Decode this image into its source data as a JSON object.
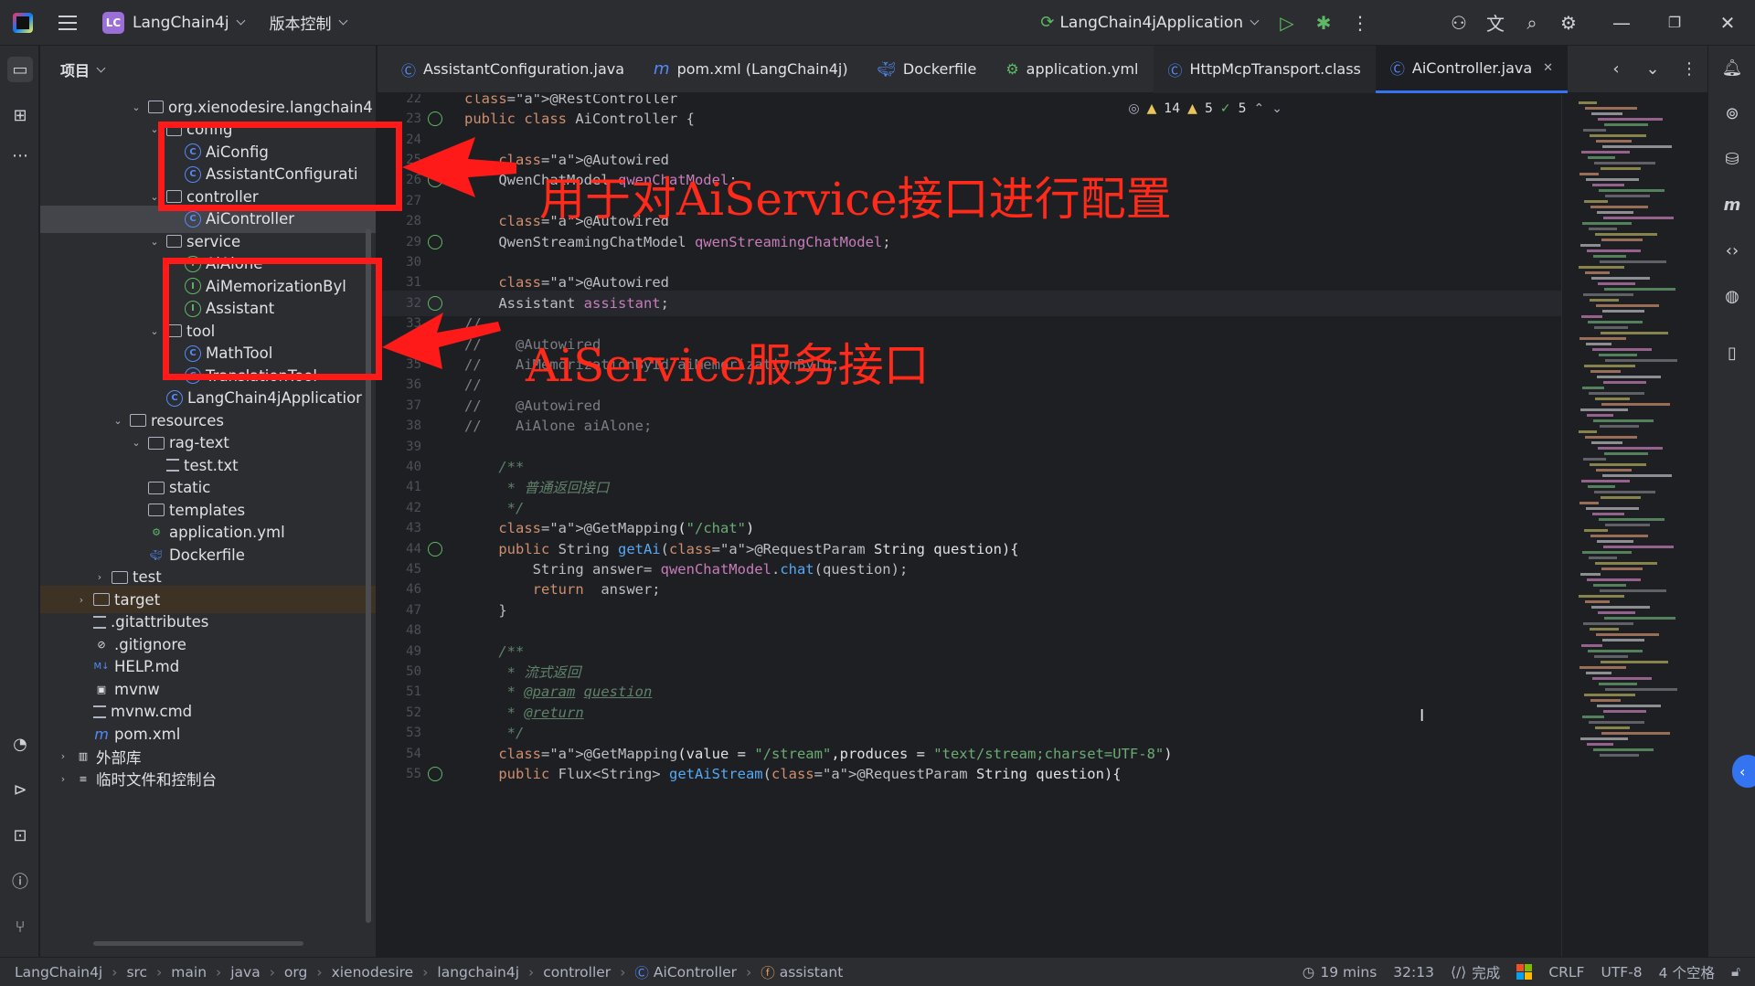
{
  "titlebar": {
    "project_badge": "LC",
    "project_name": "LangChain4j",
    "vcs_label": "版本控制",
    "run_config": "LangChain4jApplication"
  },
  "project_panel": {
    "header": "项目",
    "tree": [
      {
        "label": "org.xienodesire.langchain4",
        "type": "package",
        "arrow": "v"
      },
      {
        "label": "config",
        "type": "package",
        "arrow": "v"
      },
      {
        "label": "AiConfig",
        "type": "class"
      },
      {
        "label": "AssistantConfigurati",
        "type": "class"
      },
      {
        "label": "controller",
        "type": "package",
        "arrow": "v"
      },
      {
        "label": "AiController",
        "type": "class"
      },
      {
        "label": "service",
        "type": "package",
        "arrow": "v"
      },
      {
        "label": "AiAlone",
        "type": "interface"
      },
      {
        "label": "AiMemorizationByl",
        "type": "interface"
      },
      {
        "label": "Assistant",
        "type": "interface"
      },
      {
        "label": "tool",
        "type": "package",
        "arrow": "v"
      },
      {
        "label": "MathTool",
        "type": "class"
      },
      {
        "label": "TranslationTool",
        "type": "class"
      },
      {
        "label": "LangChain4jApplicatior",
        "type": "class"
      },
      {
        "label": "resources",
        "type": "folder",
        "arrow": "v"
      },
      {
        "label": "rag-text",
        "type": "folder",
        "arrow": "v"
      },
      {
        "label": "test.txt",
        "type": "file"
      },
      {
        "label": "static",
        "type": "folder"
      },
      {
        "label": "templates",
        "type": "folder"
      },
      {
        "label": "application.yml",
        "type": "yml"
      },
      {
        "label": "Dockerfile",
        "type": "docker"
      },
      {
        "label": "test",
        "type": "folder",
        "arrow": ">"
      },
      {
        "label": "target",
        "type": "folder",
        "arrow": ">"
      },
      {
        "label": ".gitattributes",
        "type": "file"
      },
      {
        "label": ".gitignore",
        "type": "ignore"
      },
      {
        "label": "HELP.md",
        "type": "md"
      },
      {
        "label": "mvnw",
        "type": "term"
      },
      {
        "label": "mvnw.cmd",
        "type": "file"
      },
      {
        "label": "pom.xml",
        "type": "maven"
      },
      {
        "label": "外部库",
        "type": "lib",
        "arrow": ">"
      },
      {
        "label": "临时文件和控制台",
        "type": "scratch",
        "arrow": ">"
      }
    ]
  },
  "tabs": [
    {
      "label": "AssistantConfiguration.java",
      "icon": "class-icon"
    },
    {
      "label": "pom.xml (LangChain4j)",
      "icon": "maven-icon"
    },
    {
      "label": "Dockerfile",
      "icon": "docker-icon"
    },
    {
      "label": "application.yml",
      "icon": "yml-icon"
    },
    {
      "label": "HttpMcpTransport.class",
      "icon": "class-icon"
    },
    {
      "label": "AiController.java",
      "icon": "class-icon",
      "active": true
    }
  ],
  "inspections": {
    "warnings": "14",
    "weak_warnings": "5",
    "typos": "5"
  },
  "code_lines": [
    {
      "n": "22",
      "t": "@RestController"
    },
    {
      "n": "23",
      "t": "public class AiController {"
    },
    {
      "n": "24",
      "t": ""
    },
    {
      "n": "25",
      "t": "    @Autowired"
    },
    {
      "n": "26",
      "t": "    QwenChatModel qwenChatModel;"
    },
    {
      "n": "27",
      "t": ""
    },
    {
      "n": "28",
      "t": "    @Autowired"
    },
    {
      "n": "29",
      "t": "    QwenStreamingChatModel qwenStreamingChatModel;"
    },
    {
      "n": "30",
      "t": ""
    },
    {
      "n": "31",
      "t": "    @Autowired"
    },
    {
      "n": "32",
      "t": "    Assistant assistant;"
    },
    {
      "n": "33",
      "t": "//"
    },
    {
      "n": "34",
      "t": "//    @Autowired"
    },
    {
      "n": "35",
      "t": "//    AiMemorizationById aiMemorizationById;"
    },
    {
      "n": "36",
      "t": "//"
    },
    {
      "n": "37",
      "t": "//    @Autowired"
    },
    {
      "n": "38",
      "t": "//    AiAlone aiAlone;"
    },
    {
      "n": "39",
      "t": ""
    },
    {
      "n": "40",
      "t": "    /**"
    },
    {
      "n": "41",
      "t": "     * 普通返回接口"
    },
    {
      "n": "42",
      "t": "     */"
    },
    {
      "n": "43",
      "t": "    @GetMapping(\"/chat\")"
    },
    {
      "n": "44",
      "t": "    public String getAi(@RequestParam String question){"
    },
    {
      "n": "45",
      "t": "        String answer= qwenChatModel.chat(question);"
    },
    {
      "n": "46",
      "t": "        return  answer;"
    },
    {
      "n": "47",
      "t": "    }"
    },
    {
      "n": "48",
      "t": ""
    },
    {
      "n": "49",
      "t": "    /**"
    },
    {
      "n": "50",
      "t": "     * 流式返回"
    },
    {
      "n": "51",
      "t": "     * @param question"
    },
    {
      "n": "52",
      "t": "     * @return"
    },
    {
      "n": "53",
      "t": "     */"
    },
    {
      "n": "54",
      "t": "    @GetMapping(value = \"/stream\",produces = \"text/stream;charset=UTF-8\")"
    },
    {
      "n": "55",
      "t": "    public Flux<String> getAiStream(@RequestParam String question){"
    }
  ],
  "annotations": {
    "config_note": "用于对AiService接口进行配置",
    "service_note": "AiService服务接口"
  },
  "statusbar": {
    "breadcrumbs": [
      "LangChain4j",
      "src",
      "main",
      "java",
      "org",
      "xienodesire",
      "langchain4j",
      "controller",
      "AiController",
      "assistant"
    ],
    "time_ago": "19 mins",
    "position": "32:13",
    "ai_status": "完成",
    "line_ending": "CRLF",
    "encoding": "UTF-8",
    "indent": "4 个空格"
  }
}
